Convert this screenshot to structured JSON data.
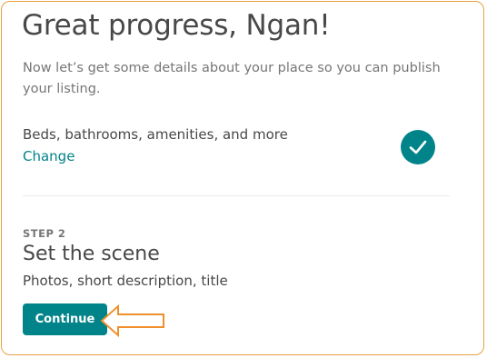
{
  "header": {
    "title": "Great progress, Ngan!",
    "subtitle": "Now let’s get some details about your place so you can publish your listing."
  },
  "completed_step": {
    "label": "Beds, bathrooms, amenities, and more",
    "change_link": "Change",
    "status_icon": "checkmark-icon"
  },
  "next_step": {
    "step_label": "STEP 2",
    "title": "Set the scene",
    "description": "Photos, short description, title",
    "button_label": "Continue"
  },
  "colors": {
    "accent": "#008489",
    "annotation_arrow": "#f0902c",
    "frame_border": "#e8a040"
  },
  "annotation": {
    "icon": "left-arrow-icon"
  }
}
